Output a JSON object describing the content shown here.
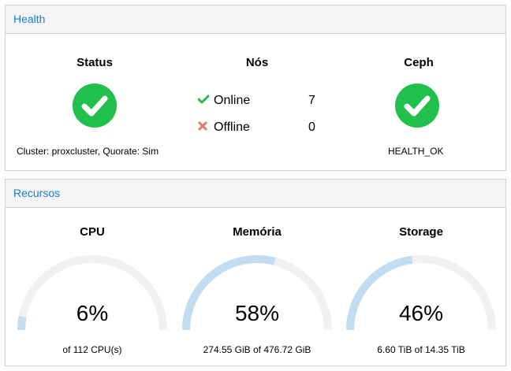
{
  "health": {
    "title": "Health",
    "status": {
      "heading": "Status",
      "icon": "check-circle-icon",
      "color": "#21bf4b",
      "cluster_text": "Cluster: proxcluster, Quorate: Sim"
    },
    "nodes": {
      "heading": "Nós",
      "online_label": "Online",
      "online_count": "7",
      "online_icon": "check-icon",
      "online_color": "#21bf4b",
      "offline_label": "Offline",
      "offline_count": "0",
      "offline_icon": "close-icon",
      "offline_color": "#f27360"
    },
    "ceph": {
      "heading": "Ceph",
      "icon": "check-circle-icon",
      "status_text": "HEALTH_OK"
    }
  },
  "resources": {
    "title": "Recursos",
    "cpu": {
      "heading": "CPU",
      "percent": 6,
      "value_text": "6%",
      "detail": "of 112 CPU(s)"
    },
    "memory": {
      "heading": "Memória",
      "percent": 58,
      "value_text": "58%",
      "detail": "274.55 GiB of 476.72 GiB"
    },
    "storage": {
      "heading": "Storage",
      "percent": 46,
      "value_text": "46%",
      "detail": "6.60 TiB of 14.35 TiB"
    },
    "gauge_fill_color": "#c2ddf2",
    "gauge_track_color": "#f1f1f1"
  }
}
